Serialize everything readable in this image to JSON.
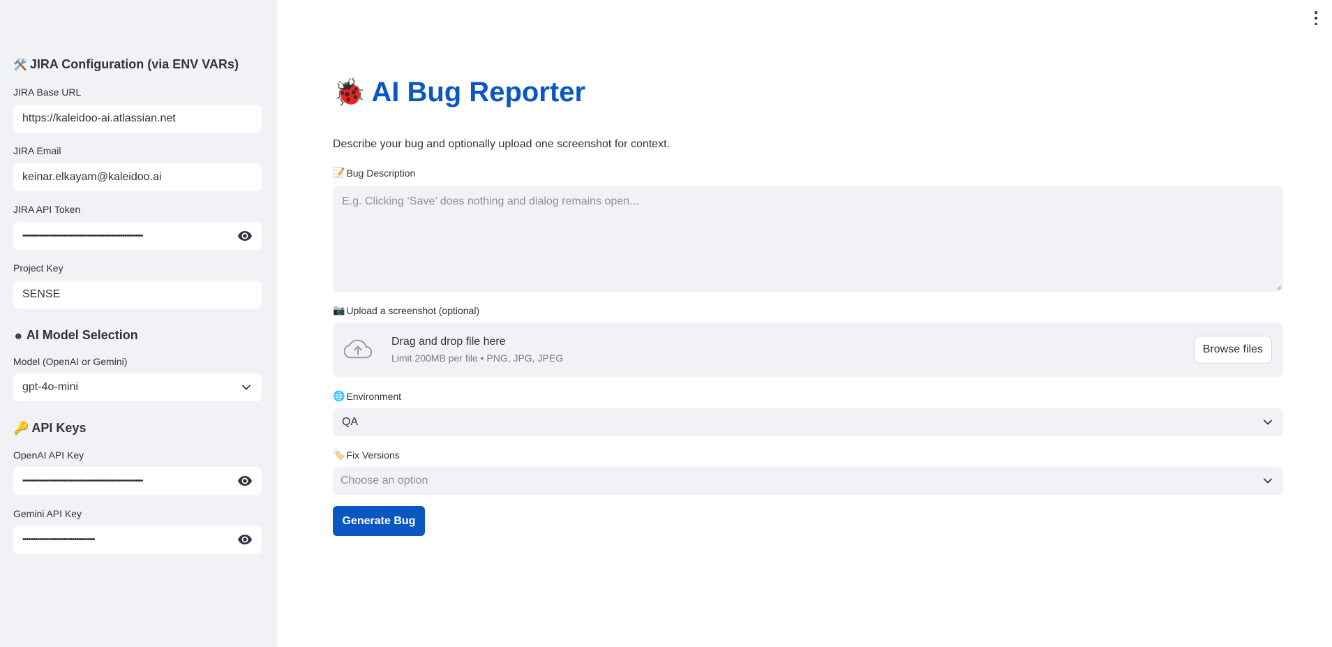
{
  "sidebar": {
    "jira_header": "JIRA Configuration (via ENV VARs)",
    "jira_header_icon": "🛠️",
    "base_url": {
      "label": "JIRA Base URL",
      "value": "https://kaleidoo-ai.atlassian.net"
    },
    "email": {
      "label": "JIRA Email",
      "value": "keinar.elkayam@kaleidoo.ai"
    },
    "api_token": {
      "label": "JIRA API Token",
      "value": "•••••••••••••••••••••••••••••••••••••••••••••••••••••••••••••••••"
    },
    "project_key": {
      "label": "Project Key",
      "value": "SENSE"
    },
    "model_header": "AI Model Selection",
    "model_header_icon": "☻",
    "model": {
      "label": "Model (OpenAI or Gemini)",
      "value": "gpt-4o-mini"
    },
    "keys_header": "API Keys",
    "keys_header_icon": "🔑",
    "openai_key": {
      "label": "OpenAI API Key",
      "value": "•••••••••••••••••••••••••••••••••••••••••••••••••••••••••••••••••"
    },
    "gemini_key": {
      "label": "Gemini API Key",
      "value": "•••••••••••••••••••••••••••••••••••••••"
    }
  },
  "main": {
    "title": "AI Bug Reporter",
    "title_icon": "🐞",
    "subtitle": "Describe your bug and optionally upload one screenshot for context.",
    "description": {
      "label": "Bug Description",
      "icon": "📝",
      "placeholder": "E.g. Clicking ‘Save’ does nothing and dialog remains open..."
    },
    "upload": {
      "label": "Upload a screenshot (optional)",
      "icon": "📷",
      "drop_text": "Drag and drop file here",
      "limit_text": "Limit 200MB per file • PNG, JPG, JPEG",
      "browse_label": "Browse files"
    },
    "environment": {
      "label": "Environment",
      "icon": "🌐",
      "value": "QA"
    },
    "fix_versions": {
      "label": "Fix Versions",
      "icon": "🏷️",
      "placeholder": "Choose an option"
    },
    "generate_label": "Generate Bug"
  },
  "colors": {
    "accent": "#0a56c2",
    "sidebar_bg": "#f0f2f6",
    "text": "#31333f"
  }
}
